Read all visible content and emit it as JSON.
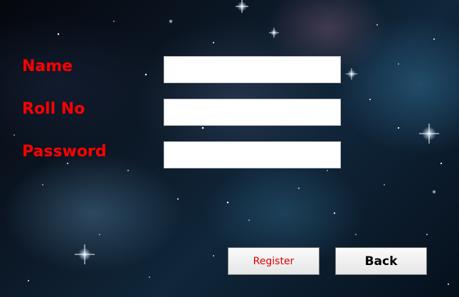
{
  "form": {
    "name_label": "Name",
    "rollno_label": "Roll No",
    "password_label": "Password",
    "name_value": "",
    "rollno_value": "",
    "password_value": ""
  },
  "buttons": {
    "register_label": "Register",
    "back_label": "Back"
  },
  "colors": {
    "label": "#ff0000",
    "register_text": "#e00000",
    "field_bg": "#ffffff"
  }
}
